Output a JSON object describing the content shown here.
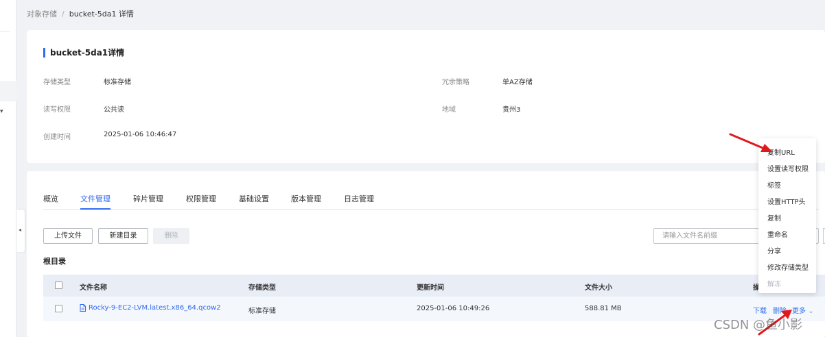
{
  "breadcrumb": {
    "parent": "对象存储",
    "separator": "/",
    "current": "bucket-5da1 详情"
  },
  "detail": {
    "title": "bucket-5da1详情",
    "storage_type_label": "存储类型",
    "storage_type_value": "标准存储",
    "redundancy_label": "冗余策略",
    "redundancy_value": "单AZ存储",
    "rw_permission_label": "读写权限",
    "rw_permission_value": "公共读",
    "region_label": "地域",
    "region_value": "贵州3",
    "created_label": "创建时间",
    "created_value": "2025-01-06 10:46:47"
  },
  "tabs": [
    "概览",
    "文件管理",
    "碎片管理",
    "权限管理",
    "基础设置",
    "版本管理",
    "日志管理"
  ],
  "toolbar": {
    "upload": "上传文件",
    "new_folder": "新建目录",
    "delete": "删除",
    "search_placeholder": "请输入文件名前缀"
  },
  "root_dir": "根目录",
  "table": {
    "headers": [
      "文件名称",
      "存储类型",
      "更新时间",
      "文件大小",
      "操"
    ],
    "rows": [
      {
        "name": "Rocky-9-EC2-LVM.latest.x86_64.qcow2",
        "storage_type": "标准存储",
        "updated": "2025-01-06 10:49:26",
        "size": "588.81 MB",
        "actions": [
          "下载",
          "删除",
          "更多"
        ]
      }
    ]
  },
  "more_menu": [
    "复制URL",
    "设置读写权限",
    "标签",
    "设置HTTP头",
    "复制",
    "重命名",
    "分享",
    "修改存储类型",
    "解冻"
  ],
  "watermark": "CSDN @鱼小影",
  "colors": {
    "accent": "#2f6bf0",
    "annotation_arrow": "#e0191d"
  }
}
